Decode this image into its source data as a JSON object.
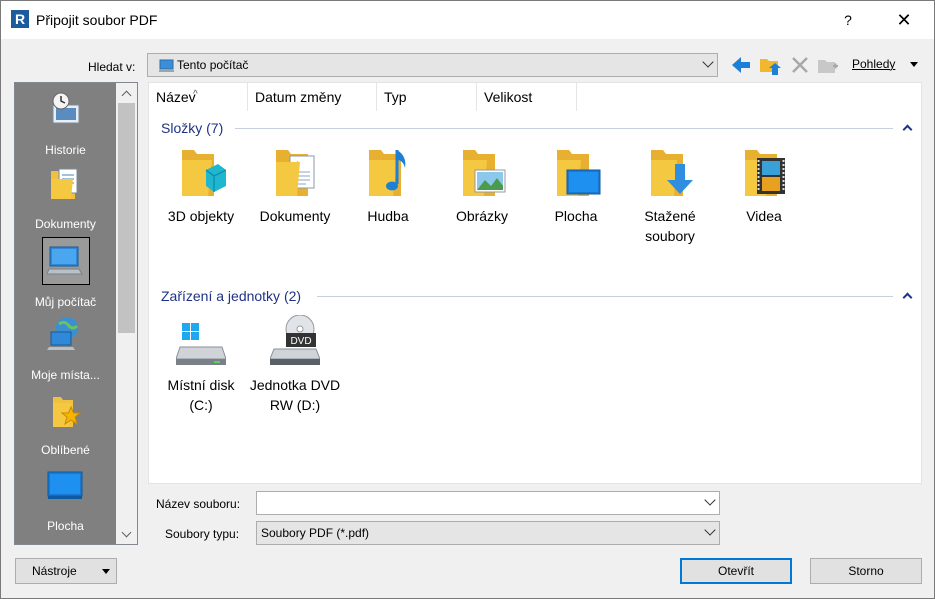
{
  "window": {
    "title": "Připojit soubor PDF",
    "help_label": "?",
    "close_label": "✕"
  },
  "lookin": {
    "label": "Hledat v:",
    "value": "Tento počítač"
  },
  "toolbar": {
    "views_label": "Pohledy"
  },
  "places": [
    {
      "label": "Historie",
      "icon": "history-icon"
    },
    {
      "label": "Dokumenty",
      "icon": "documents-icon"
    },
    {
      "label": "Můj počítač",
      "icon": "computer-icon",
      "selected": true
    },
    {
      "label": "Moje místa...",
      "icon": "network-places-icon"
    },
    {
      "label": "Oblíbené",
      "icon": "favorites-icon"
    },
    {
      "label": "Plocha",
      "icon": "desktop-icon"
    }
  ],
  "columns": [
    "Název",
    "Datum změny",
    "Typ",
    "Velikost"
  ],
  "groups": [
    {
      "title": "Složky (7)",
      "items": [
        {
          "label": "3D objekty",
          "icon": "3d-objects-folder-icon"
        },
        {
          "label": "Dokumenty",
          "icon": "documents-folder-icon"
        },
        {
          "label": "Hudba",
          "icon": "music-folder-icon"
        },
        {
          "label": "Obrázky",
          "icon": "pictures-folder-icon"
        },
        {
          "label": "Plocha",
          "icon": "desktop-folder-icon"
        },
        {
          "label": "Stažené soubory",
          "icon": "downloads-folder-icon"
        },
        {
          "label": "Videa",
          "icon": "videos-folder-icon"
        }
      ]
    },
    {
      "title": "Zařízení a jednotky (2)",
      "items": [
        {
          "label": "Místní disk (C:)",
          "icon": "local-disk-icon"
        },
        {
          "label": "Jednotka DVD RW (D:)",
          "icon": "dvd-drive-icon",
          "badge": "DVD"
        }
      ]
    }
  ],
  "filename": {
    "label": "Název souboru:",
    "value": ""
  },
  "filetype": {
    "label": "Soubory typu:",
    "value": "Soubory PDF  (*.pdf)"
  },
  "buttons": {
    "tools": "Nástroje",
    "open": "Otevřít",
    "cancel": "Storno"
  },
  "colors": {
    "folder": "#f5c842",
    "accent": "#0078d7",
    "group_title": "#1e3287",
    "places_bg": "#808080"
  }
}
